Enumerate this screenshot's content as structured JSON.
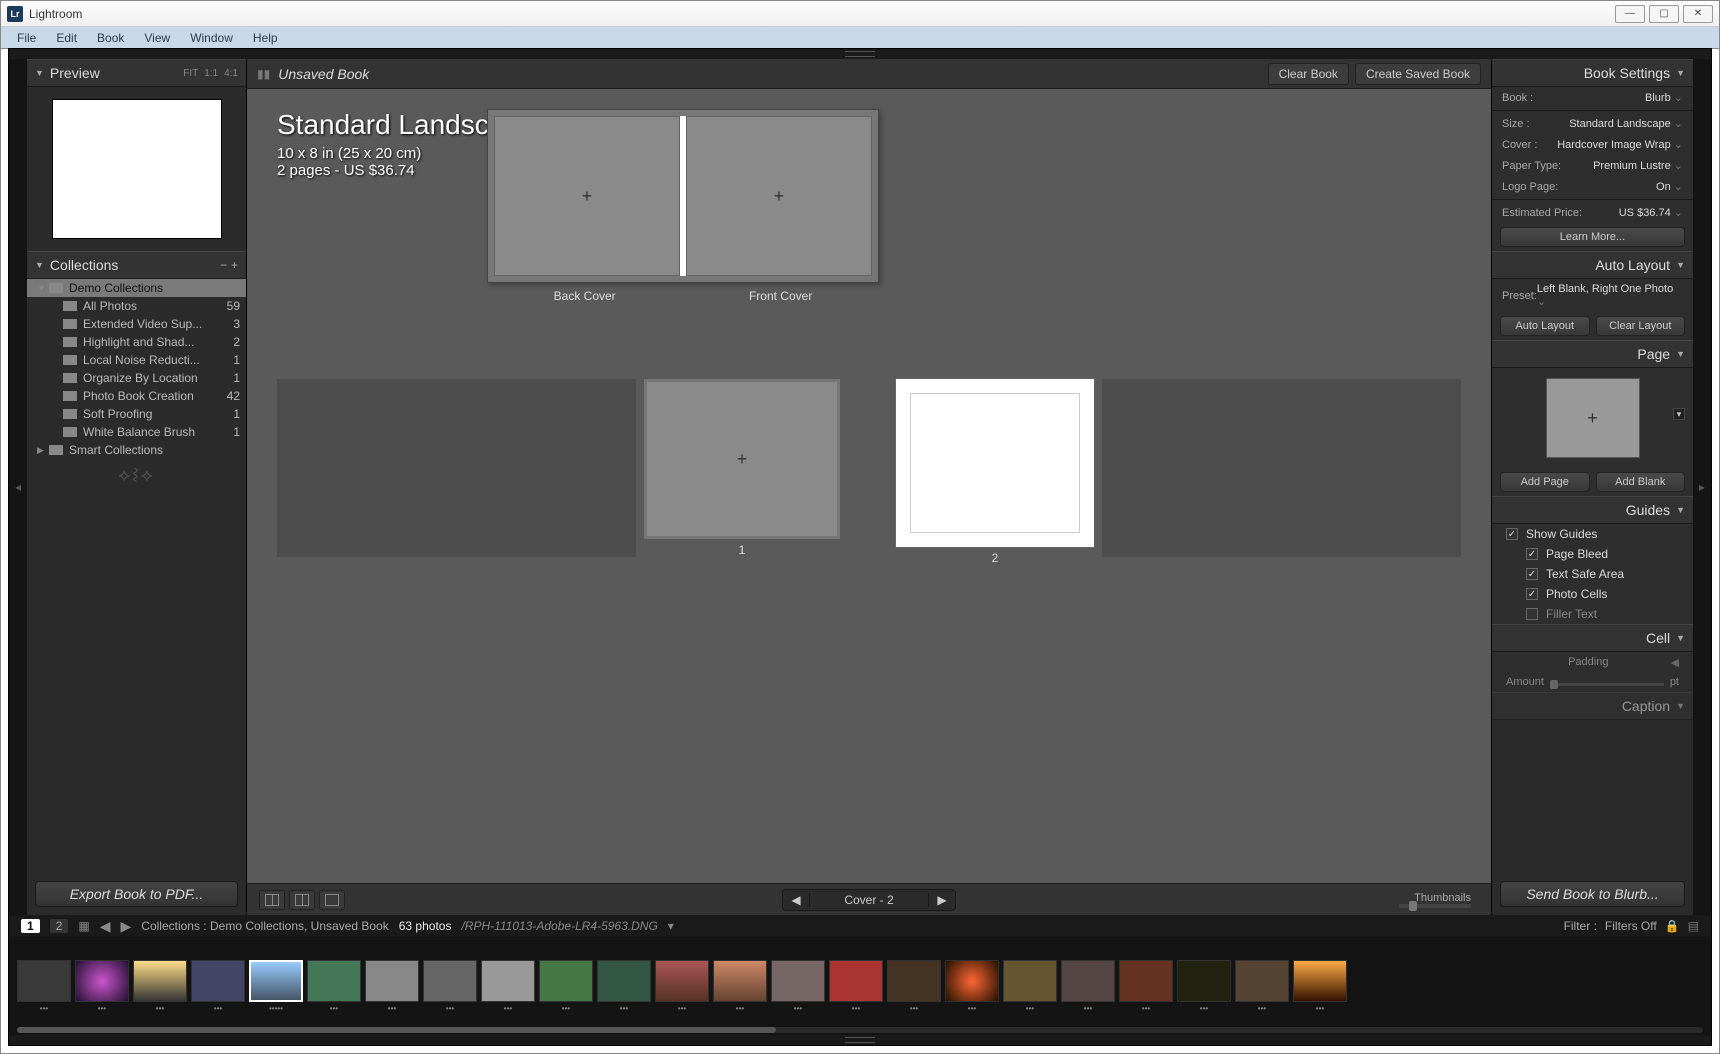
{
  "title_bar": {
    "app_name": "Lightroom"
  },
  "menu": [
    "File",
    "Edit",
    "Book",
    "View",
    "Window",
    "Help"
  ],
  "left_panel": {
    "preview": {
      "title": "Preview",
      "fit": "FIT",
      "ratio1": "1:1",
      "ratio2": "4:1"
    },
    "collections": {
      "title": "Collections",
      "parent": "Demo Collections",
      "items": [
        {
          "name": "All Photos",
          "count": "59"
        },
        {
          "name": "Extended Video Sup...",
          "count": "3"
        },
        {
          "name": "Highlight and Shad...",
          "count": "2"
        },
        {
          "name": "Local Noise Reducti...",
          "count": "1"
        },
        {
          "name": "Organize By Location",
          "count": "1"
        },
        {
          "name": "Photo Book Creation",
          "count": "42"
        },
        {
          "name": "Soft Proofing",
          "count": "1"
        },
        {
          "name": "White Balance Brush",
          "count": "1"
        }
      ],
      "smart": "Smart Collections"
    }
  },
  "center": {
    "doc_title": "Unsaved Book",
    "clear_btn": "Clear Book",
    "create_btn": "Create Saved Book",
    "heading": "Standard Landscape",
    "subtitle1": "10 x 8 in (25 x 20 cm)",
    "subtitle2": "2 pages - US $36.74",
    "back_cover": "Back Cover",
    "front_cover": "Front Cover",
    "page1": "1",
    "page2": "2",
    "pager": "Cover - 2",
    "thumbs_label": "Thumbnails"
  },
  "export_btn": "Export Book to PDF...",
  "send_btn": "Send Book to Blurb...",
  "info_bar": {
    "path": "Collections : Demo Collections, Unsaved Book",
    "count": "63 photos",
    "file": "/RPH-111013-Adobe-LR4-5963.DNG",
    "filter_label": "Filter :",
    "filter_value": "Filters Off"
  },
  "right_panel": {
    "book_settings": {
      "title": "Book Settings",
      "rows": [
        {
          "label": "Book :",
          "value": "Blurb"
        },
        {
          "label": "Size :",
          "value": "Standard Landscape"
        },
        {
          "label": "Cover :",
          "value": "Hardcover Image Wrap"
        },
        {
          "label": "Paper Type:",
          "value": "Premium Lustre"
        },
        {
          "label": "Logo Page:",
          "value": "On"
        }
      ],
      "price_label": "Estimated Price:",
      "price_value": "US $36.74",
      "learn_more": "Learn More..."
    },
    "auto_layout": {
      "title": "Auto Layout",
      "preset_label": "Preset:",
      "preset_value": "Left Blank, Right One Photo",
      "auto_btn": "Auto Layout",
      "clear_btn": "Clear Layout"
    },
    "page": {
      "title": "Page",
      "add_page": "Add Page",
      "add_blank": "Add Blank"
    },
    "guides": {
      "title": "Guides",
      "show": "Show Guides",
      "items": [
        "Page Bleed",
        "Text Safe Area",
        "Photo Cells",
        "Filler Text"
      ]
    },
    "cell": {
      "title": "Cell",
      "padding": "Padding",
      "amount": "Amount",
      "pt": "pt"
    },
    "caption": {
      "title": "Caption"
    }
  }
}
